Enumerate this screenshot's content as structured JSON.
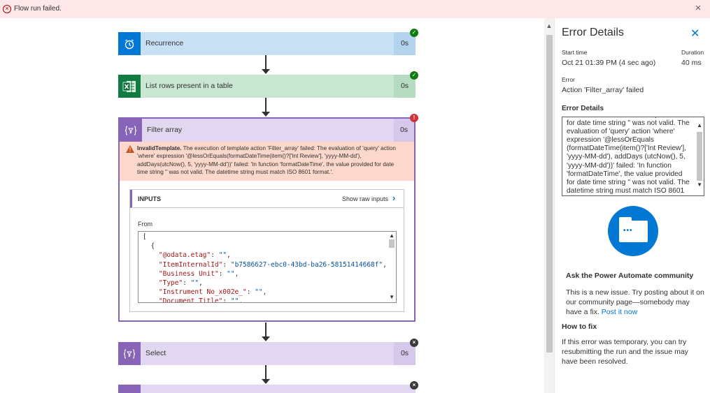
{
  "banner": {
    "icon": "error-circle-icon",
    "message": "Flow run failed.",
    "close_icon": "close-icon"
  },
  "flow": {
    "steps": [
      {
        "name": "Recurrence",
        "duration": "0s",
        "status": "succeeded",
        "icon": "alarm-clock-icon",
        "color": "#0078d4",
        "tint": "#c7e0f4"
      },
      {
        "name": "List rows present in a table",
        "duration": "0s",
        "status": "succeeded",
        "icon": "excel-icon",
        "color": "#107c41",
        "tint": "#c8e6d1"
      },
      {
        "name": "Filter array",
        "duration": "0s",
        "status": "failed",
        "icon": "data-operation-icon",
        "color": "#8764b8",
        "tint": "#e1d7f1"
      },
      {
        "name": "Select",
        "duration": "0s",
        "status": "skipped",
        "icon": "data-operation-icon",
        "color": "#8764b8",
        "tint": "#e1d7f1"
      }
    ],
    "filter_error": {
      "code": "InvalidTemplate.",
      "message": " The execution of template action 'Filter_array' failed: The evaluation of 'query' action 'where' expression '@lessOrEquals(formatDateTime(item()?['Int Review'], 'yyyy-MM-dd'), addDays(utcNow(), 5, 'yyyy-MM-dd'))' failed: 'In function 'formatDateTime', the value provided for date time string '' was not valid. The datetime string must match ISO 8601 format.'."
    },
    "inputs": {
      "header": "INPUTS",
      "show_raw": "Show raw inputs",
      "from_label": "From",
      "code_lines": [
        "[",
        "  {",
        "    \"@odata.etag\": \"\",",
        "    \"ItemInternalId\": \"b7586627-ebc0-43bd-ba26-58151414668f\",",
        "    \"Business Unit\": \"\",",
        "    \"Type\": \"\",",
        "    \"Instrument No_x002e_\": \"\",",
        "    \"Document Title\": \"\","
      ]
    }
  },
  "panel": {
    "title": "Error Details",
    "start_time_label": "Start time",
    "start_time_value": "Oct 21 01:39 PM (4 sec ago)",
    "duration_label": "Duration",
    "duration_value": "40 ms",
    "error_label": "Error",
    "error_value": "Action 'Filter_array' failed",
    "details_heading": "Error Details",
    "details_text": "'formatDateTime', the value provided for date time string '' was not valid. The evaluation of 'query' action 'where' expression '@lessOrEquals (formatDateTime(item()?['Int Review'], 'yyyy-MM-dd'), addDays (utcNow(), 5, 'yyyy-MM-dd'))' failed: 'In function 'formatDateTime', the value provided for date time string '' was not valid. The datetime string must match ISO 8601 format.'.",
    "community_heading": "Ask the Power Automate community",
    "community_text": "This is a new issue. Try posting about it on our community page—somebody may have a fix.",
    "post_link": "Post it now",
    "how_to_fix_heading": "How to fix",
    "how_to_fix_text": "If this error was temporary, you can try resubmitting the run and the issue may have been resolved."
  }
}
